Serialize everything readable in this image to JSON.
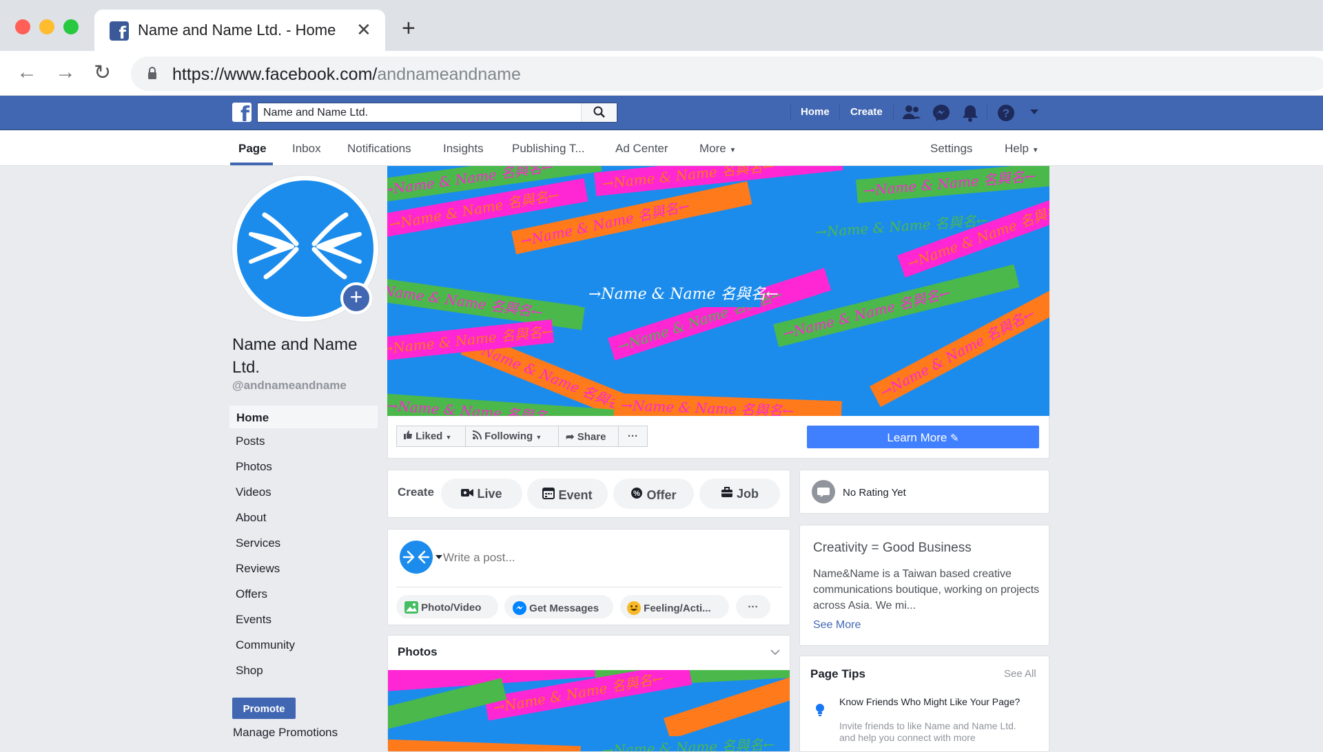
{
  "browser": {
    "tab_title": "Name and Name Ltd. - Home",
    "url_host": "https://www.facebook.com/",
    "url_path": "andnameandname",
    "traffic_light_colors": [
      "#ff5f57",
      "#febc2e",
      "#28c840"
    ]
  },
  "fb_bar": {
    "search_value": "Name and Name Ltd.",
    "home_label": "Home",
    "create_label": "Create",
    "icons": [
      "friends-icon",
      "messenger-icon",
      "notifications-icon",
      "help-icon",
      "dropdown-icon"
    ],
    "brand_color": "#4267b2"
  },
  "page_tabs": {
    "items": [
      "Page",
      "Inbox",
      "Notifications",
      "Insights",
      "Publishing T...",
      "Ad Center",
      "More"
    ],
    "right_items": [
      "Settings",
      "Help"
    ],
    "active": "Page"
  },
  "profile": {
    "name": "Name and Name Ltd.",
    "handle": "@andnameandname"
  },
  "left_nav": {
    "items": [
      "Home",
      "Posts",
      "Photos",
      "Videos",
      "About",
      "Services",
      "Reviews",
      "Offers",
      "Events",
      "Community",
      "Shop"
    ],
    "active": "Home",
    "promote_label": "Promote",
    "manage_promotions_label": "Manage Promotions"
  },
  "cover": {
    "center_text": "→Name & Name 名與名←",
    "banner_text": "→Name & Name 名與名←",
    "palette": [
      "#1c8cec",
      "#ff26d4",
      "#ff7a1a",
      "#4bb84b"
    ]
  },
  "action_bar": {
    "liked_label": "Liked",
    "following_label": "Following",
    "share_label": "Share",
    "more_label": "···",
    "learn_more_label": "Learn More"
  },
  "create_card": {
    "title": "Create",
    "buttons": [
      "Live",
      "Event",
      "Offer",
      "Job"
    ]
  },
  "composer": {
    "placeholder": "Write a post...",
    "actions": [
      "Photo/Video",
      "Get Messages",
      "Feeling/Acti..."
    ],
    "more_label": "···"
  },
  "photos_card": {
    "title": "Photos"
  },
  "rating_card": {
    "text": "No Rating Yet"
  },
  "about_card": {
    "title": "Creativity = Good Business",
    "description": "Name&Name is a Taiwan based creative communications boutique, working on projects across Asia. We mi...",
    "see_more": "See More"
  },
  "page_tips": {
    "title": "Page Tips",
    "see_all": "See All",
    "tip_title": "Know Friends Who Might Like Your Page?",
    "tip_body": "Invite friends to like Name and Name Ltd. and help you connect with more"
  }
}
